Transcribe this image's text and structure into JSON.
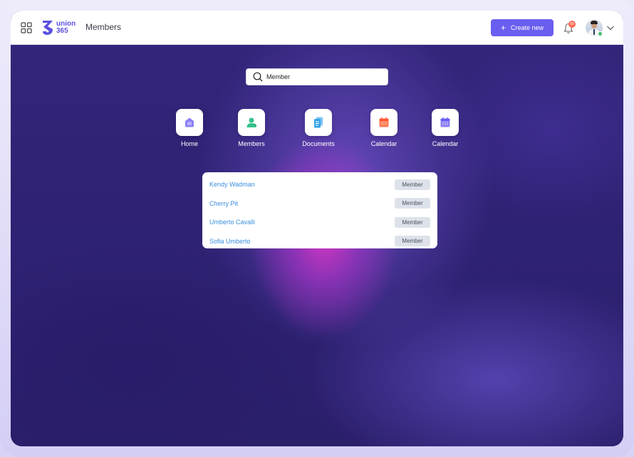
{
  "header": {
    "logo_text_line1": "union",
    "logo_text_line2": "365",
    "page_title": "Members",
    "create_button": "Create new",
    "notification_count": "55"
  },
  "search": {
    "value": "Member",
    "placeholder": ""
  },
  "apps": [
    {
      "label": "Home",
      "icon": "home-icon",
      "color": "#7b6ff2"
    },
    {
      "label": "Members",
      "icon": "member-icon",
      "color": "#32c28a"
    },
    {
      "label": "Documents",
      "icon": "documents-icon",
      "color": "#3aa3e8"
    },
    {
      "label": "Calendar",
      "icon": "calendar-icon",
      "color": "#ff7a4f"
    },
    {
      "label": "Calendar",
      "icon": "calendar-icon",
      "color": "#7b6ff2"
    }
  ],
  "results": [
    {
      "name": "Kendy Wadman",
      "tag": "Member"
    },
    {
      "name": "Cherry Pit",
      "tag": "Member"
    },
    {
      "name": "Umberto Cavalli",
      "tag": "Member"
    },
    {
      "name": "Sofia Umberto",
      "tag": "Member"
    }
  ],
  "colors": {
    "accent": "#6a5ef0",
    "link": "#3b8fe0",
    "background": "#2f2370"
  }
}
